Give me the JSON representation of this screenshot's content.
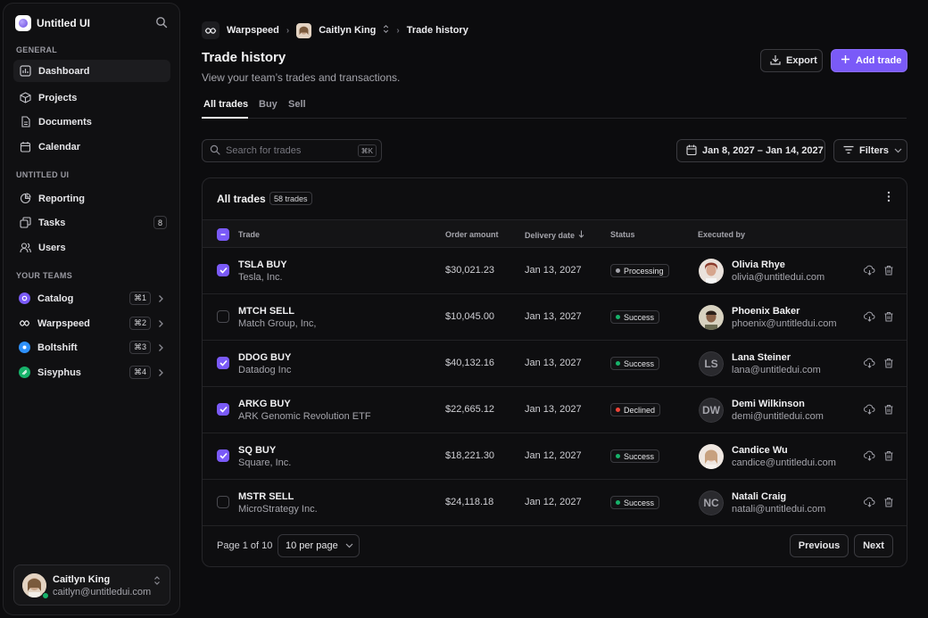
{
  "sidebar": {
    "brand": "Untitled UI",
    "sections": {
      "general": "GENERAL",
      "workspace": "UNTITLED UI",
      "teams": "YOUR TEAMS"
    },
    "general_items": [
      {
        "label": "Dashboard",
        "icon": "bar-chart-icon",
        "active": true
      },
      {
        "label": "Projects",
        "icon": "box-icon"
      },
      {
        "label": "Documents",
        "icon": "file-icon"
      },
      {
        "label": "Calendar",
        "icon": "calendar-icon"
      }
    ],
    "workspace_items": [
      {
        "label": "Reporting",
        "icon": "pie-chart-icon"
      },
      {
        "label": "Tasks",
        "icon": "layers-icon",
        "badge": "8"
      },
      {
        "label": "Users",
        "icon": "users-icon"
      }
    ],
    "teams": [
      {
        "label": "Catalog",
        "shortcut": "⌘1",
        "color": "#7a5af8"
      },
      {
        "label": "Warpspeed",
        "shortcut": "⌘2",
        "color": "#d4d4d8"
      },
      {
        "label": "Boltshift",
        "shortcut": "⌘3",
        "color": "#2e90fa"
      },
      {
        "label": "Sisyphus",
        "shortcut": "⌘4",
        "color": "#17b26a"
      }
    ],
    "user": {
      "name": "Caitlyn King",
      "email": "caitlyn@untitledui.com",
      "online_color": "#17b26a"
    }
  },
  "breadcrumb": {
    "team": "Warpspeed",
    "user": "Caitlyn King",
    "page": "Trade history"
  },
  "header": {
    "title": "Trade history",
    "subtitle": "View your team’s trades and transactions.",
    "export_label": "Export",
    "add_label": "Add trade"
  },
  "tabs": [
    "All trades",
    "Buy",
    "Sell"
  ],
  "toolbar": {
    "search_placeholder": "Search for trades",
    "search_kbd": "⌘K",
    "date_range": "Jan 8, 2027 – Jan 14, 2027",
    "filters_label": "Filters"
  },
  "table": {
    "title": "All trades",
    "count_badge": "58 trades",
    "columns": {
      "trade": "Trade",
      "amount": "Order amount",
      "date": "Delivery date",
      "status": "Status",
      "executed": "Executed by"
    },
    "rows": [
      {
        "name": "TSLA BUY",
        "company": "Tesla, Inc.",
        "amount": "$30,021.23",
        "date": "Jan 13, 2027",
        "status": "Processing",
        "status_color": "#a4a4ab",
        "checked": true,
        "exec_name": "Olivia Rhye",
        "exec_email": "olivia@untitledui.com",
        "initials": ""
      },
      {
        "name": "MTCH SELL",
        "company": "Match Group, Inc,",
        "amount": "$10,045.00",
        "date": "Jan 13, 2027",
        "status": "Success",
        "status_color": "#17b26a",
        "checked": false,
        "exec_name": "Phoenix Baker",
        "exec_email": "phoenix@untitledui.com",
        "initials": ""
      },
      {
        "name": "DDOG BUY",
        "company": "Datadog Inc",
        "amount": "$40,132.16",
        "date": "Jan 13, 2027",
        "status": "Success",
        "status_color": "#17b26a",
        "checked": true,
        "exec_name": "Lana Steiner",
        "exec_email": "lana@untitledui.com",
        "initials": "LS"
      },
      {
        "name": "ARKG BUY",
        "company": "ARK Genomic Revolution ETF",
        "amount": "$22,665.12",
        "date": "Jan 13, 2027",
        "status": "Declined",
        "status_color": "#f04438",
        "checked": true,
        "exec_name": "Demi Wilkinson",
        "exec_email": "demi@untitledui.com",
        "initials": "DW"
      },
      {
        "name": "SQ BUY",
        "company": "Square, Inc.",
        "amount": "$18,221.30",
        "date": "Jan 12, 2027",
        "status": "Success",
        "status_color": "#17b26a",
        "checked": true,
        "exec_name": "Candice Wu",
        "exec_email": "candice@untitledui.com",
        "initials": ""
      },
      {
        "name": "MSTR SELL",
        "company": "MicroStrategy Inc.",
        "amount": "$24,118.18",
        "date": "Jan 12, 2027",
        "status": "Success",
        "status_color": "#17b26a",
        "checked": false,
        "exec_name": "Natali Craig",
        "exec_email": "natali@untitledui.com",
        "initials": "NC"
      }
    ]
  },
  "pagination": {
    "page_label": "Page 1 of 10",
    "per_page": "10 per page",
    "previous": "Previous",
    "next": "Next"
  },
  "colors": {
    "accent": "#7a5af8"
  }
}
